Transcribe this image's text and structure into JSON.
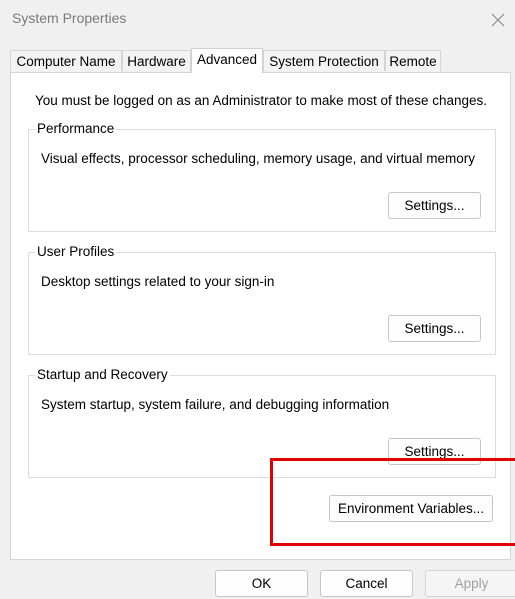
{
  "window": {
    "title": "System Properties"
  },
  "tabs": [
    {
      "label": "Computer Name",
      "active": false
    },
    {
      "label": "Hardware",
      "active": false
    },
    {
      "label": "Advanced",
      "active": true
    },
    {
      "label": "System Protection",
      "active": false
    },
    {
      "label": "Remote",
      "active": false
    }
  ],
  "advanced": {
    "admin_note": "You must be logged on as an Administrator to make most of these changes.",
    "performance": {
      "label": "Performance",
      "description": "Visual effects, processor scheduling, memory usage, and virtual memory",
      "button": "Settings..."
    },
    "user_profiles": {
      "label": "User Profiles",
      "description": "Desktop settings related to your sign-in",
      "button": "Settings..."
    },
    "startup_recovery": {
      "label": "Startup and Recovery",
      "description": "System startup, system failure, and debugging information",
      "button": "Settings..."
    },
    "env_button": "Environment Variables..."
  },
  "footer": {
    "ok": "OK",
    "cancel": "Cancel",
    "apply": "Apply"
  },
  "colors": {
    "highlight": "#e00000",
    "disabled_text": "#a0a0a0"
  }
}
